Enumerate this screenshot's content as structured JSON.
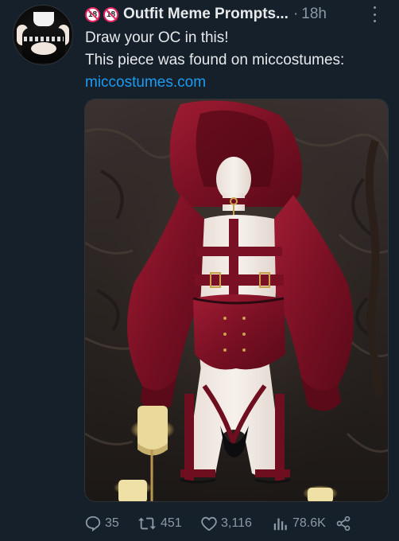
{
  "tweet": {
    "avatar_icon": "outfit-avatar",
    "badges": [
      "18",
      "18"
    ],
    "author_name": "Outfit Meme Prompts...",
    "separator": "·",
    "timestamp": "18h",
    "text_line1": "Draw your OC in this!",
    "text_line2": "This piece was found on miccostumes:",
    "link_text": "miccostumes.com"
  },
  "actions": {
    "replies": "35",
    "retweets": "451",
    "likes": "3,116",
    "views": "78.6K"
  },
  "colors": {
    "background": "#15202b",
    "text": "#e7e9ea",
    "muted": "#8b98a5",
    "link": "#1d9bf0",
    "accent_red": "#e0245e"
  }
}
